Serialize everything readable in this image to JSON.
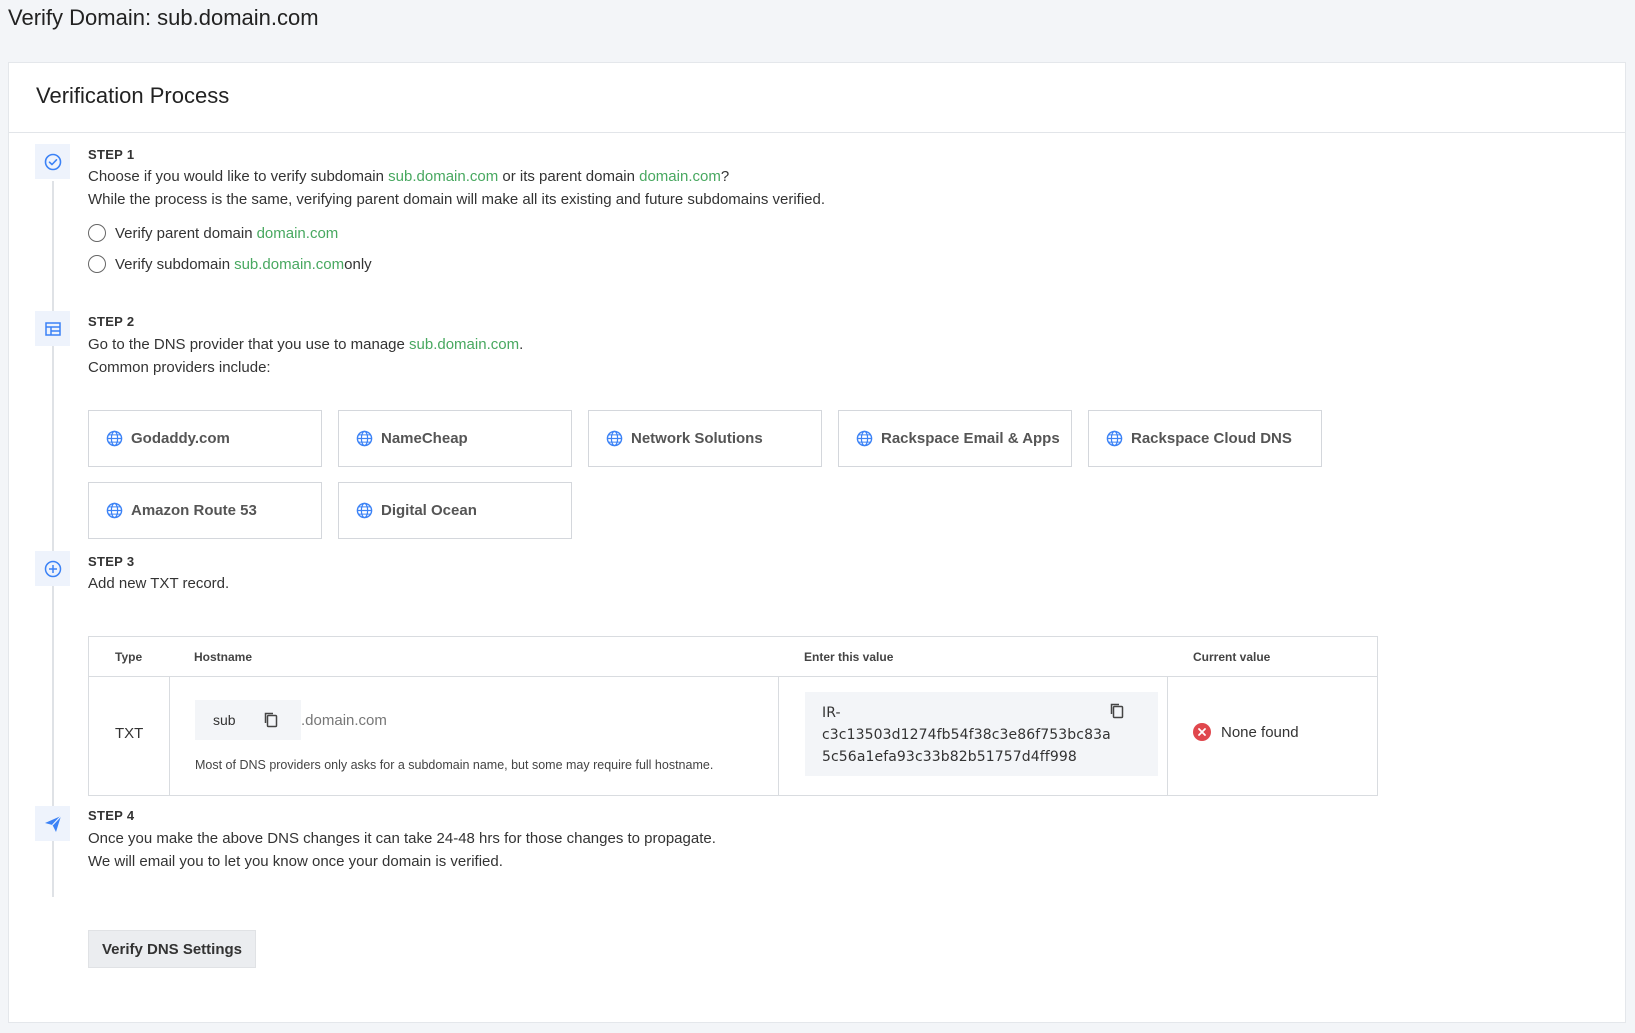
{
  "page": {
    "title": "Verify Domain: sub.domain.com"
  },
  "card": {
    "title": "Verification Process"
  },
  "steps": {
    "step1": {
      "label": "STEP 1",
      "line1_pre": "Choose if you would like to verify subdomain ",
      "line1_sub": "sub.domain.com",
      "line1_mid": " or its parent domain ",
      "line1_parent": "domain.com",
      "line1_post": "?",
      "line2": "While the process is the same, verifying parent domain will make all its existing and future subdomains verified.",
      "option_parent_pre": "Verify parent domain ",
      "option_parent_domain": "domain.com",
      "option_sub_pre": "Verify subdomain ",
      "option_sub_domain": "sub.domain.com",
      "option_sub_post": " only"
    },
    "step2": {
      "label": "STEP 2",
      "line1_pre": "Go to the DNS provider that you use to manage ",
      "line1_domain": "sub.domain.com",
      "line1_post": ".",
      "line2": "Common providers include:",
      "providers": [
        "Godaddy.com",
        "NameCheap",
        "Network Solutions",
        "Rackspace Email & Apps",
        "Rackspace Cloud DNS",
        "Amazon Route 53",
        "Digital Ocean"
      ]
    },
    "step3": {
      "label": "STEP 3",
      "line1": "Add new TXT record.",
      "table": {
        "headers": {
          "type": "Type",
          "hostname": "Hostname",
          "value": "Enter this value",
          "current": "Current value"
        },
        "type": "TXT",
        "host_sub": "sub",
        "host_suffix": ".domain.com",
        "host_hint": "Most of DNS providers only asks for a subdomain name, but some may require full hostname.",
        "value_lines": [
          "IR-",
          "c3c13503d1274fb54f38c3e86f753bc83a",
          "5c56a1efa93c33b82b51757d4ff998"
        ],
        "current": "None found"
      }
    },
    "step4": {
      "label": "STEP 4",
      "line1": "Once you make the above DNS changes it can take 24-48 hrs for those changes to propagate.",
      "line2": "We will email you to let you know once your domain is verified.",
      "button": "Verify DNS Settings"
    }
  },
  "colors": {
    "accent_green": "#48a860",
    "icon_blue": "#3b82f6",
    "error_red": "#e0474d"
  },
  "icons": [
    "check-circle-icon",
    "table-icon",
    "plus-circle-icon",
    "send-icon",
    "globe-icon",
    "copy-icon",
    "x-circle-icon"
  ]
}
